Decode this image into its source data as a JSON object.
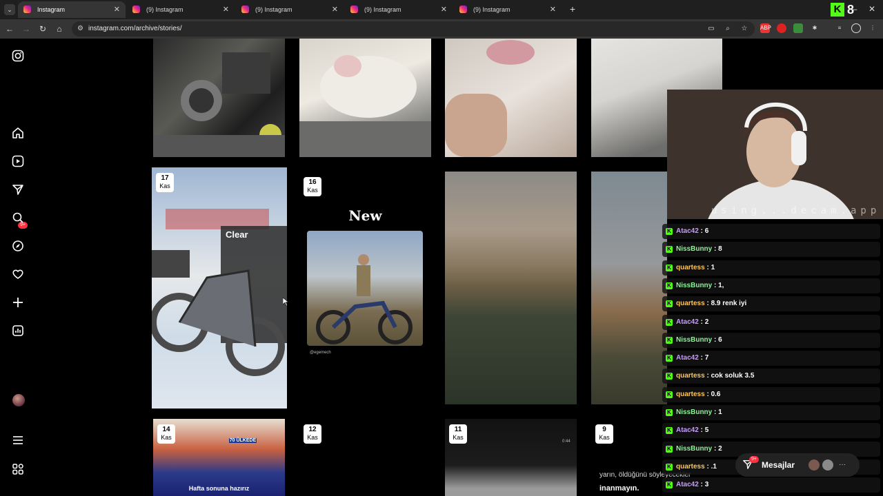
{
  "browser": {
    "tabs": [
      {
        "title": "Instagram",
        "active": true
      },
      {
        "title": "(9) Instagram",
        "active": false
      },
      {
        "title": "(9) Instagram",
        "active": false
      },
      {
        "title": "(9) Instagram",
        "active": false
      },
      {
        "title": "(9) Instagram",
        "active": false
      }
    ],
    "url": "instagram.com/archive/stories/",
    "kick_badge": {
      "letter": "K",
      "count": "8"
    },
    "extensions": [
      "ABP",
      "record",
      "shield",
      "puzzle"
    ]
  },
  "sidebar": {
    "notifications_badge": "9+",
    "items": [
      "instagram-logo",
      "home",
      "reels",
      "direct-messages",
      "search",
      "explore",
      "notifications",
      "create",
      "dashboard",
      "profile",
      "more",
      "also-from-meta"
    ]
  },
  "stories": [
    {
      "day": "",
      "month": "",
      "caption": ""
    },
    {
      "day": "",
      "month": "",
      "caption": ""
    },
    {
      "day": "",
      "month": "",
      "caption": ""
    },
    {
      "day": "",
      "month": "",
      "caption": ""
    },
    {
      "day": "17",
      "month": "Kas",
      "caption": "Clear"
    },
    {
      "day": "16",
      "month": "Kas",
      "caption": "New",
      "subcaption": "@egemech"
    },
    {
      "day": "",
      "month": "",
      "caption": ""
    },
    {
      "day": "",
      "month": "",
      "caption": ""
    },
    {
      "day": "14",
      "month": "Kas",
      "caption": "Hafta sonuna hazırız",
      "banner": "70 ÜLKEDE"
    },
    {
      "day": "12",
      "month": "Kas",
      "caption": ""
    },
    {
      "day": "11",
      "month": "Kas",
      "caption": "",
      "time": "0:44"
    },
    {
      "day": "9",
      "month": "Kas",
      "caption": "yarın, öldüğünü söyleyecekler",
      "caption2": "inanmayın."
    }
  ],
  "webcam": {
    "watermark": "using...decam.app"
  },
  "chat": [
    {
      "user": "Atac42",
      "msg": "6",
      "style": "atac"
    },
    {
      "user": "NissBunny",
      "msg": "8",
      "style": "niss"
    },
    {
      "user": "quartess",
      "msg": "1",
      "style": "quar"
    },
    {
      "user": "NissBunny",
      "msg": "1,",
      "style": "niss"
    },
    {
      "user": "quartess",
      "msg": "8.9 renk iyi",
      "style": "quar"
    },
    {
      "user": "Atac42",
      "msg": "2",
      "style": "atac"
    },
    {
      "user": "NissBunny",
      "msg": "6",
      "style": "niss"
    },
    {
      "user": "Atac42",
      "msg": "7",
      "style": "atac"
    },
    {
      "user": "quartess",
      "msg": "cok soluk 3.5",
      "style": "quar"
    },
    {
      "user": "quartess",
      "msg": "0.6",
      "style": "quar"
    },
    {
      "user": "NissBunny",
      "msg": "1",
      "style": "niss"
    },
    {
      "user": "Atac42",
      "msg": "5",
      "style": "atac"
    },
    {
      "user": "NissBunny",
      "msg": "2",
      "style": "niss"
    },
    {
      "user": "quartess",
      "msg": ".1",
      "style": "quar"
    },
    {
      "user": "Atac42",
      "msg": "3",
      "style": "atac"
    }
  ],
  "messages": {
    "label": "Mesajlar",
    "badge": "9+"
  }
}
